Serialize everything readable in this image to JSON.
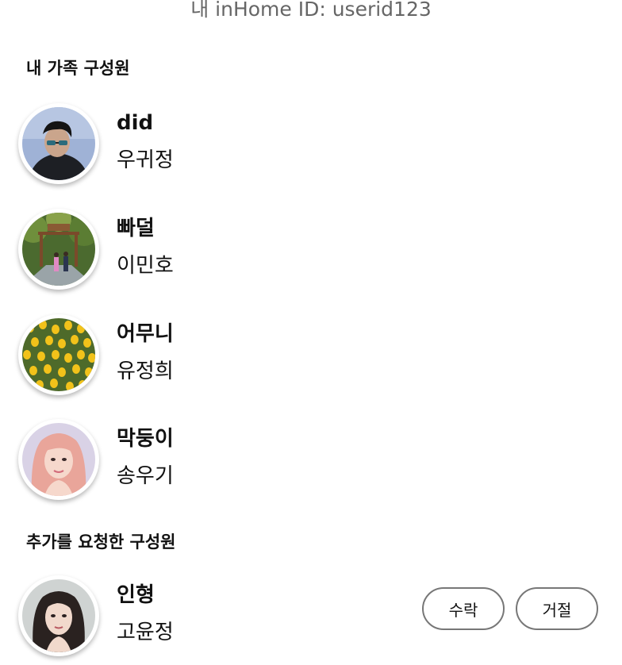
{
  "header": {
    "user_id_text": "내 inHome ID: userid123"
  },
  "sections": {
    "family_title": "내 가족 구성원",
    "requests_title": "추가를 요청한 구성원"
  },
  "family_members": [
    {
      "nickname": "did",
      "name": "우귀정",
      "avatar": "man-with-sunglasses-photo"
    },
    {
      "nickname": "빠덜",
      "name": "이민호",
      "avatar": "park-walkers-photo"
    },
    {
      "nickname": "어무니",
      "name": "유정희",
      "avatar": "tulips-photo"
    },
    {
      "nickname": "막둥이",
      "name": "송우기",
      "avatar": "pink-hair-woman-photo"
    }
  ],
  "requests": [
    {
      "nickname": "인형",
      "name": "고윤정",
      "avatar": "dark-hair-woman-photo",
      "accept_label": "수락",
      "reject_label": "거절"
    }
  ]
}
